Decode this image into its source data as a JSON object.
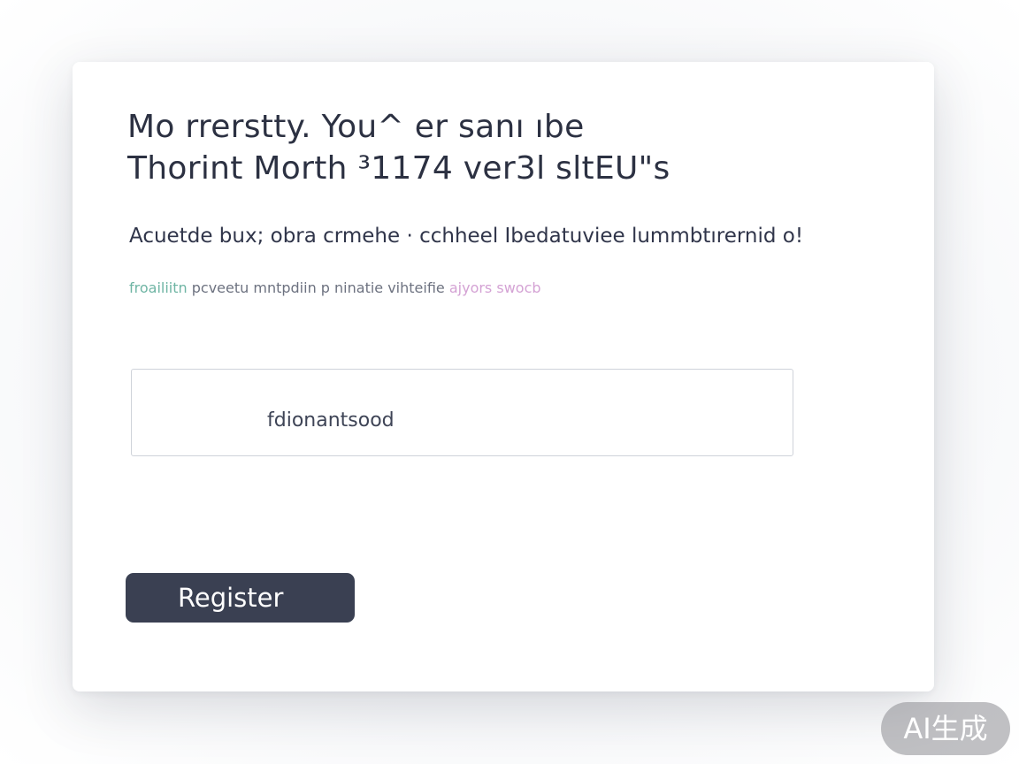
{
  "form": {
    "title_line1": "Mo rrerstty. You^ er sanı ıbe",
    "title_line2": "Thorint Morth ³1174 ver3l sltEU\"s",
    "subtitle": "Acuetde bux; obra crmehe · cchheel Ibedatuviee lummbtırernid o!",
    "hint_part1": "froailiitn",
    "hint_part2": "pcveetu mntpdiin p ninatie vihteifie",
    "hint_part3": "ajyors swocb",
    "input_value": "fdionantsood",
    "register_label": "Register"
  },
  "watermark": {
    "label": "AI生成"
  },
  "colors": {
    "button_bg": "#3a4052",
    "text": "#2c3142",
    "hint_teal": "#6fb5a4",
    "hint_pink": "#d4a2d4"
  }
}
